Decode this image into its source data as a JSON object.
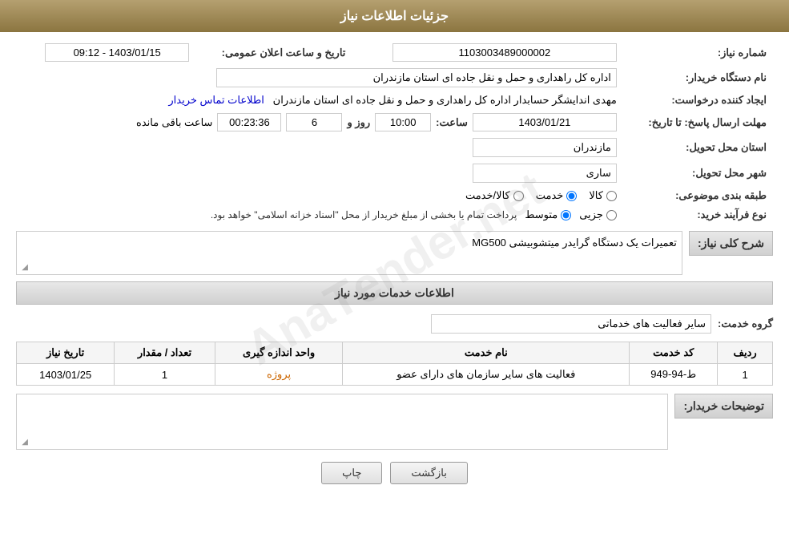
{
  "header": {
    "title": "جزئیات اطلاعات نیاز"
  },
  "fields": {
    "need_number_label": "شماره نیاز:",
    "need_number_value": "1103003489000002",
    "announce_datetime_label": "تاریخ و ساعت اعلان عمومی:",
    "announce_datetime_value": "1403/01/15 - 09:12",
    "buyer_org_label": "نام دستگاه خریدار:",
    "buyer_org_value": "اداره کل راهداری و حمل و نقل جاده ای استان مازندران",
    "creator_label": "ایجاد کننده درخواست:",
    "creator_value": "مهدی اندایشگر حسابدار اداره کل راهداری و حمل و نقل جاده ای استان مازندران",
    "creator_link": "اطلاعات تماس خریدار",
    "deadline_label": "مهلت ارسال پاسخ: تا تاریخ:",
    "deadline_date": "1403/01/21",
    "deadline_time_label": "ساعت:",
    "deadline_time": "10:00",
    "deadline_days_label": "روز و",
    "deadline_days": "6",
    "deadline_remaining_label": "ساعت باقی مانده",
    "deadline_remaining": "00:23:36",
    "delivery_province_label": "استان محل تحویل:",
    "delivery_province": "مازندران",
    "delivery_city_label": "شهر محل تحویل:",
    "delivery_city": "ساری",
    "category_label": "طبقه بندی موضوعی:",
    "category_options": [
      "کالا",
      "خدمت",
      "کالا/خدمت"
    ],
    "category_selected": "خدمت",
    "purchase_type_label": "نوع فرآیند خرید:",
    "purchase_type_options": [
      "جزیی",
      "متوسط"
    ],
    "purchase_type_selected": "متوسط",
    "purchase_type_note": "پرداخت تمام یا بخشی از مبلغ خریدار از محل \"اسناد خزانه اسلامی\" خواهد بود.",
    "need_desc_label": "شرح کلی نیاز:",
    "need_desc_value": "تعمیرات یک دستگاه گرایدر میتشوبیشی MG500",
    "service_info_title": "اطلاعات خدمات مورد نیاز",
    "service_group_label": "گروه خدمت:",
    "service_group_value": "سایر فعالیت های خدماتی",
    "service_table": {
      "headers": [
        "ردیف",
        "کد خدمت",
        "نام خدمت",
        "واحد اندازه گیری",
        "تعداد / مقدار",
        "تاریخ نیاز"
      ],
      "rows": [
        {
          "row": "1",
          "code": "ط-94-949",
          "name": "فعالیت های سایر سازمان های دارای عضو",
          "unit": "پروژه",
          "quantity": "1",
          "date": "1403/01/25"
        }
      ]
    },
    "buyer_notes_label": "توضیحات خریدار:",
    "buyer_notes_value": ""
  },
  "buttons": {
    "print": "چاپ",
    "back": "بازگشت"
  },
  "watermark": "AnaТender.net"
}
